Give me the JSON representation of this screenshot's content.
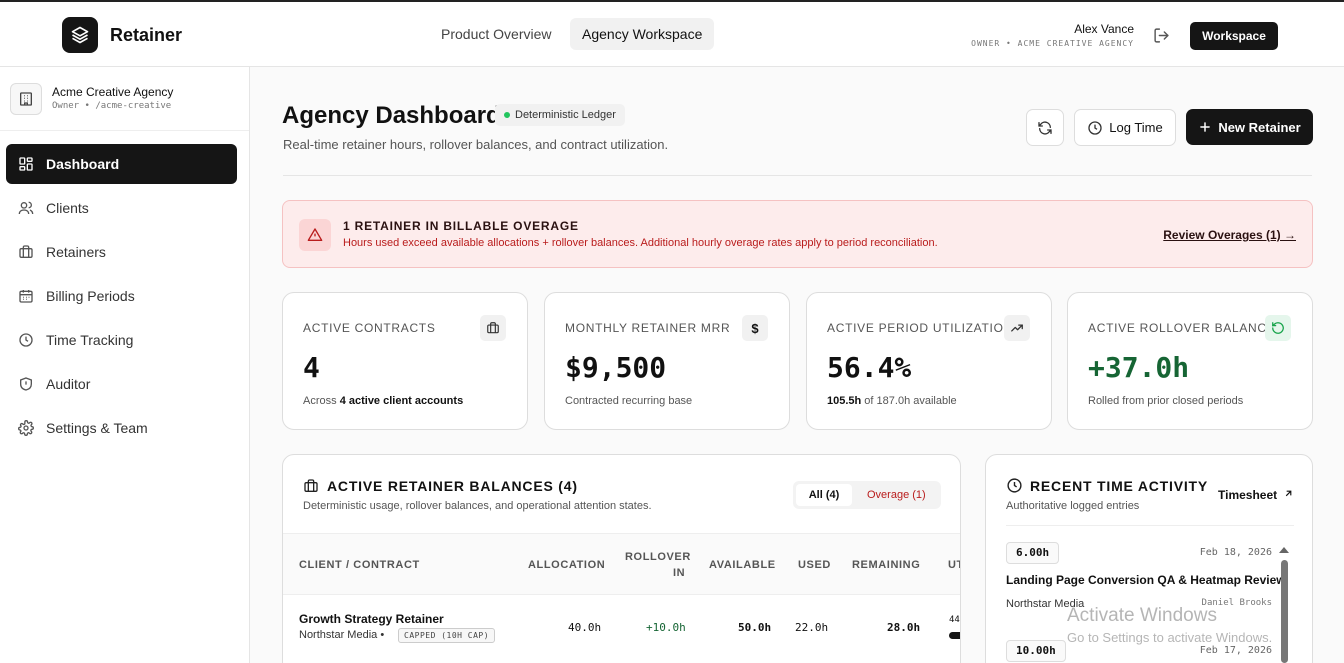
{
  "topbar": {
    "brand": "Retainer",
    "tabs": [
      "Product Overview",
      "Agency Workspace"
    ],
    "active_tab": "Agency Workspace",
    "user_name": "Alex Vance",
    "user_role": "OWNER • ACME CREATIVE AGENCY",
    "workspace_button": "Workspace"
  },
  "sidebar": {
    "org_name": "Acme Creative Agency",
    "org_sub": "Owner • /acme-creative",
    "items": [
      {
        "label": "Dashboard",
        "icon": "grid-icon",
        "active": true
      },
      {
        "label": "Clients",
        "icon": "users-icon"
      },
      {
        "label": "Retainers",
        "icon": "briefcase-icon"
      },
      {
        "label": "Billing Periods",
        "icon": "calendar-icon"
      },
      {
        "label": "Time Tracking",
        "icon": "clock-icon"
      },
      {
        "label": "Auditor",
        "icon": "shield-icon"
      },
      {
        "label": "Settings & Team",
        "icon": "gear-icon"
      }
    ]
  },
  "header": {
    "title": "Agency Dashboard",
    "badge": "Deterministic Ledger",
    "subtitle": "Real-time retainer hours, rollover balances, and contract utilization.",
    "log_time": "Log Time",
    "new_retainer": "New Retainer"
  },
  "alert": {
    "title": "1 RETAINER IN BILLABLE OVERAGE",
    "text": "Hours used exceed available allocations + rollover balances. Additional hourly overage rates apply to period reconciliation.",
    "link": "Review Overages (1) →"
  },
  "cards": [
    {
      "label": "ACTIVE CONTRACTS",
      "icon": "briefcase-icon",
      "value": "4",
      "foot_pre": "Across ",
      "foot_bold": "4 active client accounts",
      "foot_post": ""
    },
    {
      "label": "MONTHLY RETAINER MRR",
      "icon": "dollar-icon",
      "icon_glyph": "$",
      "value": "$9,500",
      "foot_pre": "Contracted recurring base",
      "foot_bold": "",
      "foot_post": ""
    },
    {
      "label": "ACTIVE PERIOD UTILIZATION",
      "icon": "trending-up-icon",
      "value": "56.4%",
      "foot_pre": "",
      "foot_bold": "105.5h",
      "foot_post": " of 187.0h available"
    },
    {
      "label": "ACTIVE ROLLOVER BALANCE",
      "icon": "rotate-icon",
      "value": "+37.0h",
      "foot_pre": "Rolled from prior closed periods",
      "foot_bold": "",
      "foot_post": ""
    }
  ],
  "balances": {
    "title": "ACTIVE RETAINER BALANCES (4)",
    "subtitle": "Deterministic usage, rollover balances, and operational attention states.",
    "filter_all": "All (4)",
    "filter_overage": "Overage (1)",
    "columns": [
      "CLIENT / CONTRACT",
      "ALLOCATION",
      "ROLLOVER",
      "IN",
      "AVAILABLE",
      "USED",
      "REMAINING",
      "UT"
    ],
    "rows": [
      {
        "name": "Growth Strategy Retainer",
        "client": "Northstar Media",
        "sep": "•",
        "tag": "CAPPED (10H CAP)",
        "allocation": "40.0h",
        "rollover": "+10.0h",
        "available": "50.0h",
        "used": "22.0h",
        "remaining": "28.0h",
        "ut": "44"
      }
    ]
  },
  "activity": {
    "title": "RECENT TIME ACTIVITY",
    "subtitle": "Authoritative logged entries",
    "link": "Timesheet",
    "entries": [
      {
        "hours": "6.00h",
        "date": "Feb 18, 2026",
        "desc": "Landing Page Conversion QA & Heatmap Review",
        "client": "Northstar Media",
        "user": "Daniel Brooks"
      },
      {
        "hours": "10.00h",
        "date": "Feb 17, 2026"
      }
    ]
  },
  "watermark": {
    "line1": "Activate Windows",
    "line2": "Go to Settings to activate Windows."
  },
  "colors": {
    "accent": "#151515",
    "danger": "#b91c1c",
    "success": "#166534",
    "status_dot": "#22c55e"
  }
}
